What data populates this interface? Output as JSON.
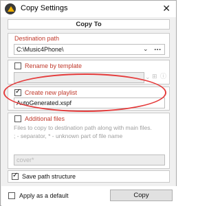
{
  "window": {
    "title": "Copy Settings",
    "close_glyph": "✕"
  },
  "section": {
    "header": "Copy To"
  },
  "destination": {
    "legend": "Destination path",
    "value": "C:\\Music4Phone\\",
    "dropdown_glyph": "⌄",
    "browse_label": "..."
  },
  "rename": {
    "legend": "Rename by template",
    "checked": false,
    "value": ""
  },
  "playlist": {
    "legend": "Create new playlist",
    "checked": true,
    "value": "AutoGenerated.xspf"
  },
  "additional": {
    "legend": "Additional files",
    "checked": false,
    "hint_line1": "Files to copy to destination path along with main files.",
    "hint_line2": "; - separator, * - unknown part of file name",
    "placeholder": "cover*"
  },
  "save_structure": {
    "label": "Save path structure",
    "checked": true
  },
  "footer": {
    "apply_default_label": "Apply as a default",
    "apply_default_checked": false,
    "copy_button": "Copy"
  },
  "colors": {
    "accent_legend": "#c0392b",
    "annotation_circle": "#e53b3b"
  }
}
